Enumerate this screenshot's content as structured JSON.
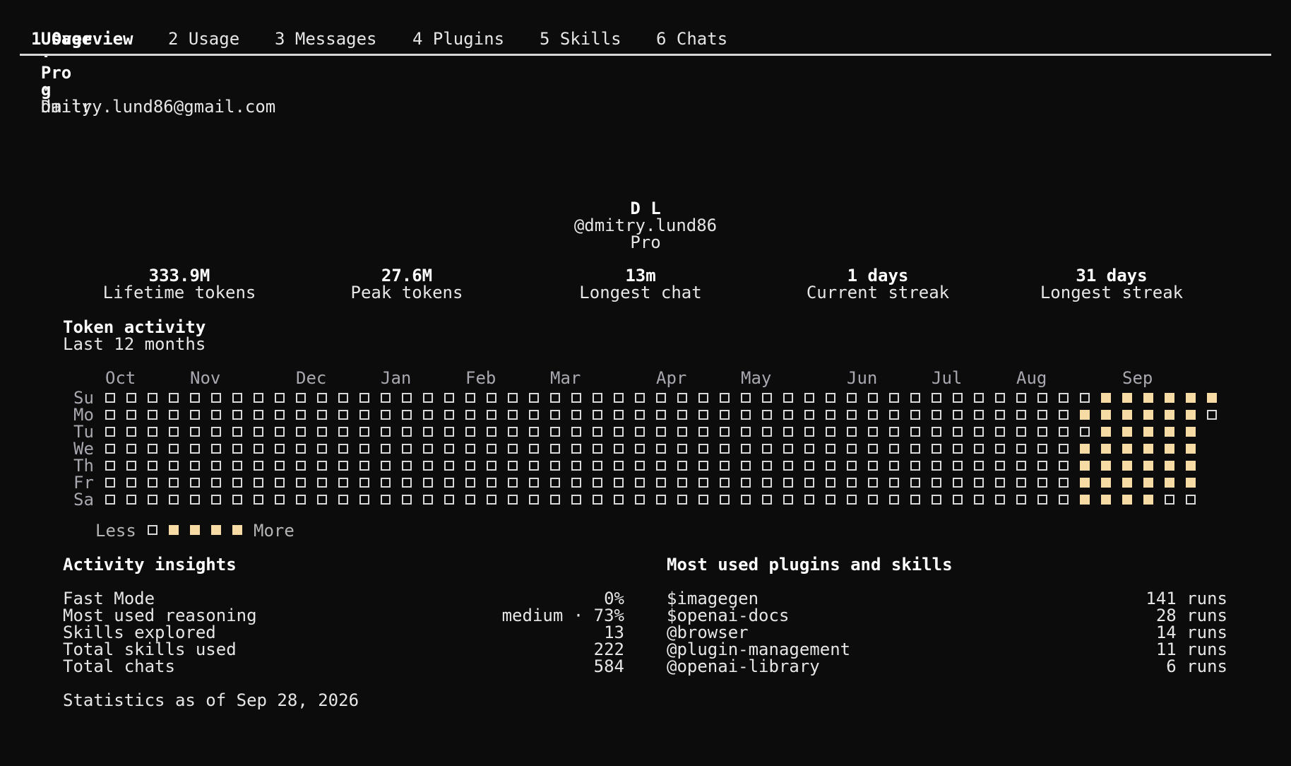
{
  "header": {
    "app": "Usage",
    "sep1": "·",
    "plan": "Pro",
    "sep2": "·",
    "email": "dmitry.lund86@gmail.com"
  },
  "tabs": [
    {
      "label": "1 Overview",
      "active": true
    },
    {
      "label": "2 Usage",
      "active": false
    },
    {
      "label": "3 Messages",
      "active": false
    },
    {
      "label": "4 Plugins",
      "active": false
    },
    {
      "label": "5 Skills",
      "active": false
    },
    {
      "label": "6 Chats",
      "active": false
    }
  ],
  "toggle": {
    "key": "g",
    "label": "Daily"
  },
  "profile": {
    "initials": "D L",
    "handle": "@dmitry.lund86",
    "plan": "Pro"
  },
  "stats": [
    {
      "value": "333.9M",
      "label": "Lifetime tokens"
    },
    {
      "value": "27.6M",
      "label": "Peak tokens"
    },
    {
      "value": "13m",
      "label": "Longest chat"
    },
    {
      "value": "1 days",
      "label": "Current streak"
    },
    {
      "value": "31 days",
      "label": "Longest streak"
    }
  ],
  "activity": {
    "title": "Token activity",
    "subtitle": "Last 12 months",
    "months": [
      "Oct",
      "Nov",
      "Dec",
      "Jan",
      "Feb",
      "Mar",
      "Apr",
      "May",
      "Jun",
      "Jul",
      "Aug",
      "Sep"
    ],
    "days": [
      "Su",
      "Mo",
      "Tu",
      "We",
      "Th",
      "Fr",
      "Sa"
    ],
    "weeks": 52,
    "grid": {
      "Su": {
        "empty_until": 46,
        "filled": [
          47,
          48,
          49,
          50,
          51,
          52
        ],
        "length": 53
      },
      "Mo": {
        "empty_until": 45,
        "filled": [
          46,
          47,
          48,
          49,
          50,
          51
        ],
        "length": 53
      },
      "Tu": {
        "empty_until": 46,
        "filled": [
          47,
          48,
          49,
          50,
          51
        ],
        "length": 52
      },
      "We": {
        "empty_until": 45,
        "filled": [
          46,
          47,
          48,
          49,
          50,
          51
        ],
        "length": 52
      },
      "Th": {
        "empty_until": 45,
        "filled": [
          46,
          47,
          48,
          49,
          50,
          51
        ],
        "length": 52
      },
      "Fr": {
        "empty_until": 45,
        "filled": [
          46,
          47,
          48,
          49,
          50,
          51
        ],
        "length": 52
      },
      "Sa": {
        "empty_until": 45,
        "filled": [
          46,
          47,
          48,
          49
        ],
        "length": 52
      }
    },
    "legend_less": "Less",
    "legend_more": "More",
    "fill_color": "#f6dca4"
  },
  "insights": {
    "title": "Activity insights",
    "rows": [
      {
        "label": "Fast Mode",
        "value": "0%"
      },
      {
        "label": "Most used reasoning",
        "value": "medium · 73%"
      },
      {
        "label": "Skills explored",
        "value": "13"
      },
      {
        "label": "Total skills used",
        "value": "222"
      },
      {
        "label": "Total chats",
        "value": "584"
      }
    ],
    "footer": "Statistics as of Sep 28, 2026"
  },
  "plugins": {
    "title": "Most used plugins and skills",
    "rows": [
      {
        "name": "$imagegen",
        "runs": "141 runs"
      },
      {
        "name": "$openai-docs",
        "runs": "28 runs"
      },
      {
        "name": "@browser",
        "runs": "14 runs"
      },
      {
        "name": "@plugin-management",
        "runs": "11 runs"
      },
      {
        "name": "@openai-library",
        "runs": "6 runs"
      }
    ]
  }
}
